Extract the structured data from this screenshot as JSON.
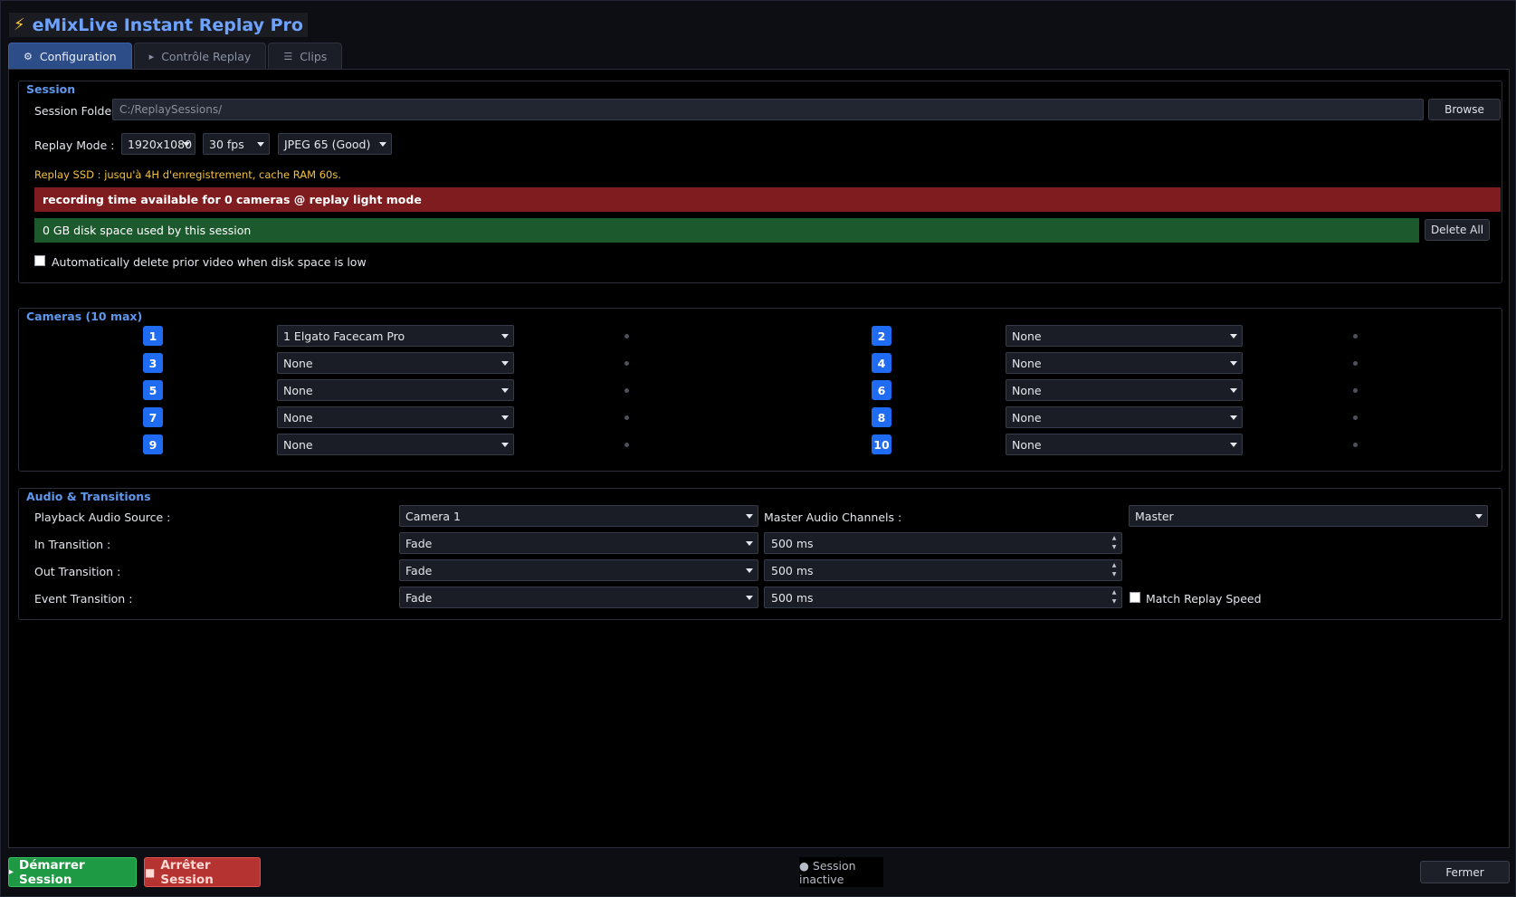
{
  "app": {
    "icon": "lightning-bolt-icon",
    "title": "eMixLive Instant Replay Pro"
  },
  "tabs": [
    {
      "icon": "gear-icon",
      "glyph": "⚙",
      "label": "Configuration",
      "active": true
    },
    {
      "icon": "play-icon",
      "glyph": "▸",
      "label": "Contrôle Replay",
      "active": false
    },
    {
      "icon": "clips-icon",
      "glyph": "☰",
      "label": "Clips",
      "active": false
    }
  ],
  "session": {
    "title": "Session",
    "folder_label": "Session Folder :",
    "folder_placeholder": "C:/ReplaySessions/",
    "browse_label": "Browse",
    "replay_mode_label": "Replay Mode :",
    "resolution": "1920x1080",
    "fps": "30 fps",
    "quality": "JPEG 65 (Good)",
    "ssd_note": "Replay SSD : jusqu'à 4H d'enregistrement, cache RAM 60s.",
    "recording_banner": "recording time available for 0 cameras @ replay light mode",
    "disk_banner": "0 GB disk space used by this session",
    "delete_all_label": "Delete All",
    "auto_delete_label": "Automatically delete prior video when disk space is low",
    "auto_delete_checked": false
  },
  "cameras": {
    "title": "Cameras (10 max)",
    "slots": [
      {
        "number": "1",
        "source": "1  Elgato Facecam Pro"
      },
      {
        "number": "2",
        "source": "None"
      },
      {
        "number": "3",
        "source": "None"
      },
      {
        "number": "4",
        "source": "None"
      },
      {
        "number": "5",
        "source": "None"
      },
      {
        "number": "6",
        "source": "None"
      },
      {
        "number": "7",
        "source": "None"
      },
      {
        "number": "8",
        "source": "None"
      },
      {
        "number": "9",
        "source": "None"
      },
      {
        "number": "10",
        "source": "None"
      }
    ]
  },
  "audio": {
    "title": "Audio & Transitions",
    "playback_source_label": "Playback Audio Source :",
    "playback_source": "Camera 1",
    "master_channels_label": "Master Audio Channels :",
    "master_channels": "Master",
    "in_label": "In Transition :",
    "in_type": "Fade",
    "in_duration": "500 ms",
    "out_label": "Out Transition :",
    "out_type": "Fade",
    "out_duration": "500 ms",
    "event_label": "Event Transition :",
    "event_type": "Fade",
    "event_duration": "500 ms",
    "match_speed_label": "Match Replay Speed",
    "match_speed_checked": false
  },
  "footer": {
    "start_icon": "play-icon",
    "start_label": "Démarrer Session",
    "stop_icon": "stop-icon",
    "stop_label": "Arrêter Session",
    "status": "● Session inactive",
    "close_label": "Fermer"
  },
  "colors": {
    "accent": "#1f6bf2",
    "group_title": "#5f97ec",
    "recording_banner": "#7f1c1f",
    "disk_banner": "#1c5a2e",
    "note": "#f0c040",
    "start": "#1f9a44",
    "stop": "#b53331"
  }
}
